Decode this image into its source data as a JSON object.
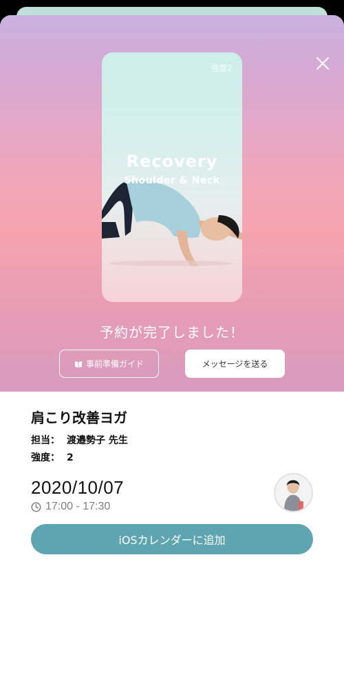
{
  "hero": {
    "thumbnail": {
      "intensity_tag": "強度2",
      "title": "Recovery",
      "subtitle": "Shoulder & Neck"
    },
    "completion_message": "予約が完了しました！",
    "guide_button_label": "事前準備ガイド",
    "message_button_label": "メッセージを送る"
  },
  "detail": {
    "class_name": "肩こり改善ヨガ",
    "instructor_key": "担当：",
    "instructor_value": "渡邉勢子 先生",
    "intensity_key": "強度：",
    "intensity_value": "2",
    "date": "2020/10/07",
    "time": "17:00 - 17:30",
    "calendar_button_label": "iOSカレンダーに追加"
  },
  "colors": {
    "accent": "#5ea5b1",
    "hero_top": "#c9b0df",
    "hero_mid": "#f5a3ae"
  },
  "icons": {
    "close": "close-icon",
    "guide": "book-icon",
    "time": "clock-icon"
  }
}
